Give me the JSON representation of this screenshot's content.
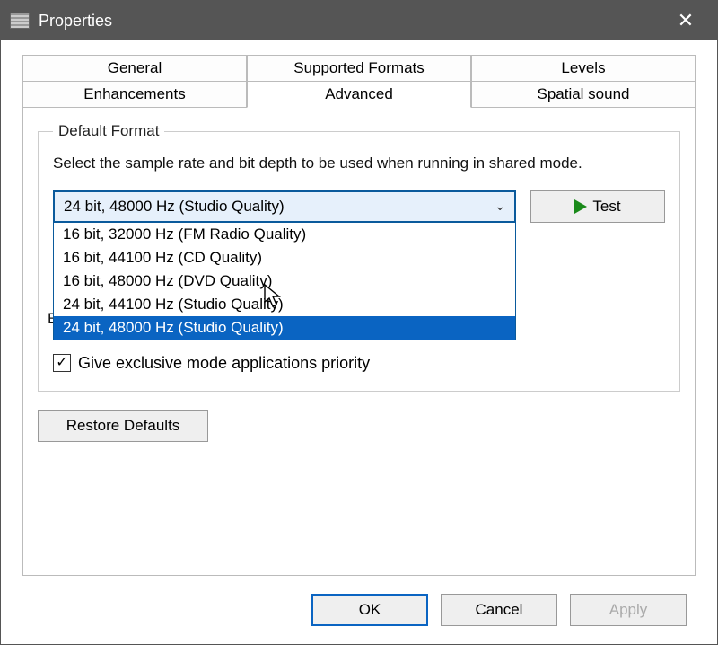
{
  "window": {
    "title": "Properties"
  },
  "tabs": {
    "row1": [
      "General",
      "Supported Formats",
      "Levels"
    ],
    "row2": [
      "Enhancements",
      "Advanced",
      "Spatial sound"
    ],
    "active": "Advanced"
  },
  "default_format": {
    "legend": "Default Format",
    "desc": "Select the sample rate and bit depth to be used when running in shared mode.",
    "selected": "24 bit, 48000 Hz (Studio Quality)",
    "options": [
      "16 bit, 32000 Hz (FM Radio Quality)",
      "16 bit, 44100 Hz (CD Quality)",
      "16 bit, 48000 Hz (DVD Quality)",
      "24 bit, 44100 Hz (Studio Quality)",
      "24 bit, 48000 Hz (Studio Quality)"
    ],
    "test_label": "Test"
  },
  "exclusive": {
    "priority_label": "Give exclusive mode applications priority",
    "priority_checked": true
  },
  "partial_text": "E",
  "restore_label": "Restore Defaults",
  "buttons": {
    "ok": "OK",
    "cancel": "Cancel",
    "apply": "Apply"
  }
}
